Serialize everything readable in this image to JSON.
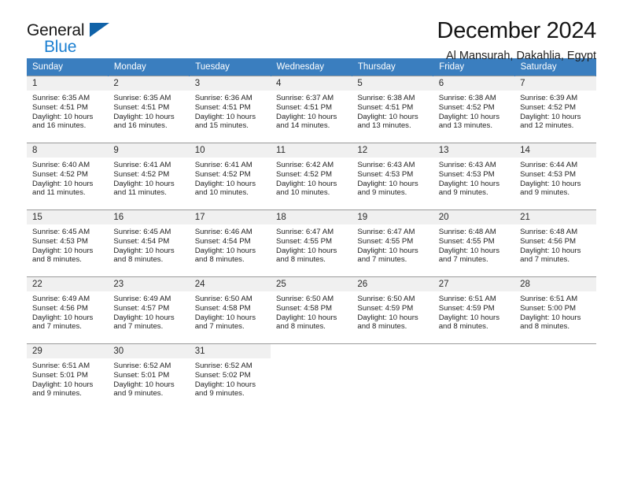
{
  "brand": {
    "name_top": "General",
    "name_bottom": "Blue",
    "accent_color": "#1b7fd1",
    "triangle_color": "#1062a8"
  },
  "header": {
    "title": "December 2024",
    "subtitle": "Al Mansurah, Dakahlia, Egypt"
  },
  "theme": {
    "header_band": "#3a7ebf",
    "daynum_band": "#f0f0f0",
    "grid_line": "#9a9a9a",
    "text": "#232323"
  },
  "weekdays": [
    "Sunday",
    "Monday",
    "Tuesday",
    "Wednesday",
    "Thursday",
    "Friday",
    "Saturday"
  ],
  "weeks": [
    [
      {
        "day": "1",
        "sunrise": "Sunrise: 6:35 AM",
        "sunset": "Sunset: 4:51 PM",
        "daylight1": "Daylight: 10 hours",
        "daylight2": "and 16 minutes."
      },
      {
        "day": "2",
        "sunrise": "Sunrise: 6:35 AM",
        "sunset": "Sunset: 4:51 PM",
        "daylight1": "Daylight: 10 hours",
        "daylight2": "and 16 minutes."
      },
      {
        "day": "3",
        "sunrise": "Sunrise: 6:36 AM",
        "sunset": "Sunset: 4:51 PM",
        "daylight1": "Daylight: 10 hours",
        "daylight2": "and 15 minutes."
      },
      {
        "day": "4",
        "sunrise": "Sunrise: 6:37 AM",
        "sunset": "Sunset: 4:51 PM",
        "daylight1": "Daylight: 10 hours",
        "daylight2": "and 14 minutes."
      },
      {
        "day": "5",
        "sunrise": "Sunrise: 6:38 AM",
        "sunset": "Sunset: 4:51 PM",
        "daylight1": "Daylight: 10 hours",
        "daylight2": "and 13 minutes."
      },
      {
        "day": "6",
        "sunrise": "Sunrise: 6:38 AM",
        "sunset": "Sunset: 4:52 PM",
        "daylight1": "Daylight: 10 hours",
        "daylight2": "and 13 minutes."
      },
      {
        "day": "7",
        "sunrise": "Sunrise: 6:39 AM",
        "sunset": "Sunset: 4:52 PM",
        "daylight1": "Daylight: 10 hours",
        "daylight2": "and 12 minutes."
      }
    ],
    [
      {
        "day": "8",
        "sunrise": "Sunrise: 6:40 AM",
        "sunset": "Sunset: 4:52 PM",
        "daylight1": "Daylight: 10 hours",
        "daylight2": "and 11 minutes."
      },
      {
        "day": "9",
        "sunrise": "Sunrise: 6:41 AM",
        "sunset": "Sunset: 4:52 PM",
        "daylight1": "Daylight: 10 hours",
        "daylight2": "and 11 minutes."
      },
      {
        "day": "10",
        "sunrise": "Sunrise: 6:41 AM",
        "sunset": "Sunset: 4:52 PM",
        "daylight1": "Daylight: 10 hours",
        "daylight2": "and 10 minutes."
      },
      {
        "day": "11",
        "sunrise": "Sunrise: 6:42 AM",
        "sunset": "Sunset: 4:52 PM",
        "daylight1": "Daylight: 10 hours",
        "daylight2": "and 10 minutes."
      },
      {
        "day": "12",
        "sunrise": "Sunrise: 6:43 AM",
        "sunset": "Sunset: 4:53 PM",
        "daylight1": "Daylight: 10 hours",
        "daylight2": "and 9 minutes."
      },
      {
        "day": "13",
        "sunrise": "Sunrise: 6:43 AM",
        "sunset": "Sunset: 4:53 PM",
        "daylight1": "Daylight: 10 hours",
        "daylight2": "and 9 minutes."
      },
      {
        "day": "14",
        "sunrise": "Sunrise: 6:44 AM",
        "sunset": "Sunset: 4:53 PM",
        "daylight1": "Daylight: 10 hours",
        "daylight2": "and 9 minutes."
      }
    ],
    [
      {
        "day": "15",
        "sunrise": "Sunrise: 6:45 AM",
        "sunset": "Sunset: 4:53 PM",
        "daylight1": "Daylight: 10 hours",
        "daylight2": "and 8 minutes."
      },
      {
        "day": "16",
        "sunrise": "Sunrise: 6:45 AM",
        "sunset": "Sunset: 4:54 PM",
        "daylight1": "Daylight: 10 hours",
        "daylight2": "and 8 minutes."
      },
      {
        "day": "17",
        "sunrise": "Sunrise: 6:46 AM",
        "sunset": "Sunset: 4:54 PM",
        "daylight1": "Daylight: 10 hours",
        "daylight2": "and 8 minutes."
      },
      {
        "day": "18",
        "sunrise": "Sunrise: 6:47 AM",
        "sunset": "Sunset: 4:55 PM",
        "daylight1": "Daylight: 10 hours",
        "daylight2": "and 8 minutes."
      },
      {
        "day": "19",
        "sunrise": "Sunrise: 6:47 AM",
        "sunset": "Sunset: 4:55 PM",
        "daylight1": "Daylight: 10 hours",
        "daylight2": "and 7 minutes."
      },
      {
        "day": "20",
        "sunrise": "Sunrise: 6:48 AM",
        "sunset": "Sunset: 4:55 PM",
        "daylight1": "Daylight: 10 hours",
        "daylight2": "and 7 minutes."
      },
      {
        "day": "21",
        "sunrise": "Sunrise: 6:48 AM",
        "sunset": "Sunset: 4:56 PM",
        "daylight1": "Daylight: 10 hours",
        "daylight2": "and 7 minutes."
      }
    ],
    [
      {
        "day": "22",
        "sunrise": "Sunrise: 6:49 AM",
        "sunset": "Sunset: 4:56 PM",
        "daylight1": "Daylight: 10 hours",
        "daylight2": "and 7 minutes."
      },
      {
        "day": "23",
        "sunrise": "Sunrise: 6:49 AM",
        "sunset": "Sunset: 4:57 PM",
        "daylight1": "Daylight: 10 hours",
        "daylight2": "and 7 minutes."
      },
      {
        "day": "24",
        "sunrise": "Sunrise: 6:50 AM",
        "sunset": "Sunset: 4:58 PM",
        "daylight1": "Daylight: 10 hours",
        "daylight2": "and 7 minutes."
      },
      {
        "day": "25",
        "sunrise": "Sunrise: 6:50 AM",
        "sunset": "Sunset: 4:58 PM",
        "daylight1": "Daylight: 10 hours",
        "daylight2": "and 8 minutes."
      },
      {
        "day": "26",
        "sunrise": "Sunrise: 6:50 AM",
        "sunset": "Sunset: 4:59 PM",
        "daylight1": "Daylight: 10 hours",
        "daylight2": "and 8 minutes."
      },
      {
        "day": "27",
        "sunrise": "Sunrise: 6:51 AM",
        "sunset": "Sunset: 4:59 PM",
        "daylight1": "Daylight: 10 hours",
        "daylight2": "and 8 minutes."
      },
      {
        "day": "28",
        "sunrise": "Sunrise: 6:51 AM",
        "sunset": "Sunset: 5:00 PM",
        "daylight1": "Daylight: 10 hours",
        "daylight2": "and 8 minutes."
      }
    ],
    [
      {
        "day": "29",
        "sunrise": "Sunrise: 6:51 AM",
        "sunset": "Sunset: 5:01 PM",
        "daylight1": "Daylight: 10 hours",
        "daylight2": "and 9 minutes."
      },
      {
        "day": "30",
        "sunrise": "Sunrise: 6:52 AM",
        "sunset": "Sunset: 5:01 PM",
        "daylight1": "Daylight: 10 hours",
        "daylight2": "and 9 minutes."
      },
      {
        "day": "31",
        "sunrise": "Sunrise: 6:52 AM",
        "sunset": "Sunset: 5:02 PM",
        "daylight1": "Daylight: 10 hours",
        "daylight2": "and 9 minutes."
      },
      {
        "day": "",
        "sunrise": "",
        "sunset": "",
        "daylight1": "",
        "daylight2": ""
      },
      {
        "day": "",
        "sunrise": "",
        "sunset": "",
        "daylight1": "",
        "daylight2": ""
      },
      {
        "day": "",
        "sunrise": "",
        "sunset": "",
        "daylight1": "",
        "daylight2": ""
      },
      {
        "day": "",
        "sunrise": "",
        "sunset": "",
        "daylight1": "",
        "daylight2": ""
      }
    ]
  ]
}
